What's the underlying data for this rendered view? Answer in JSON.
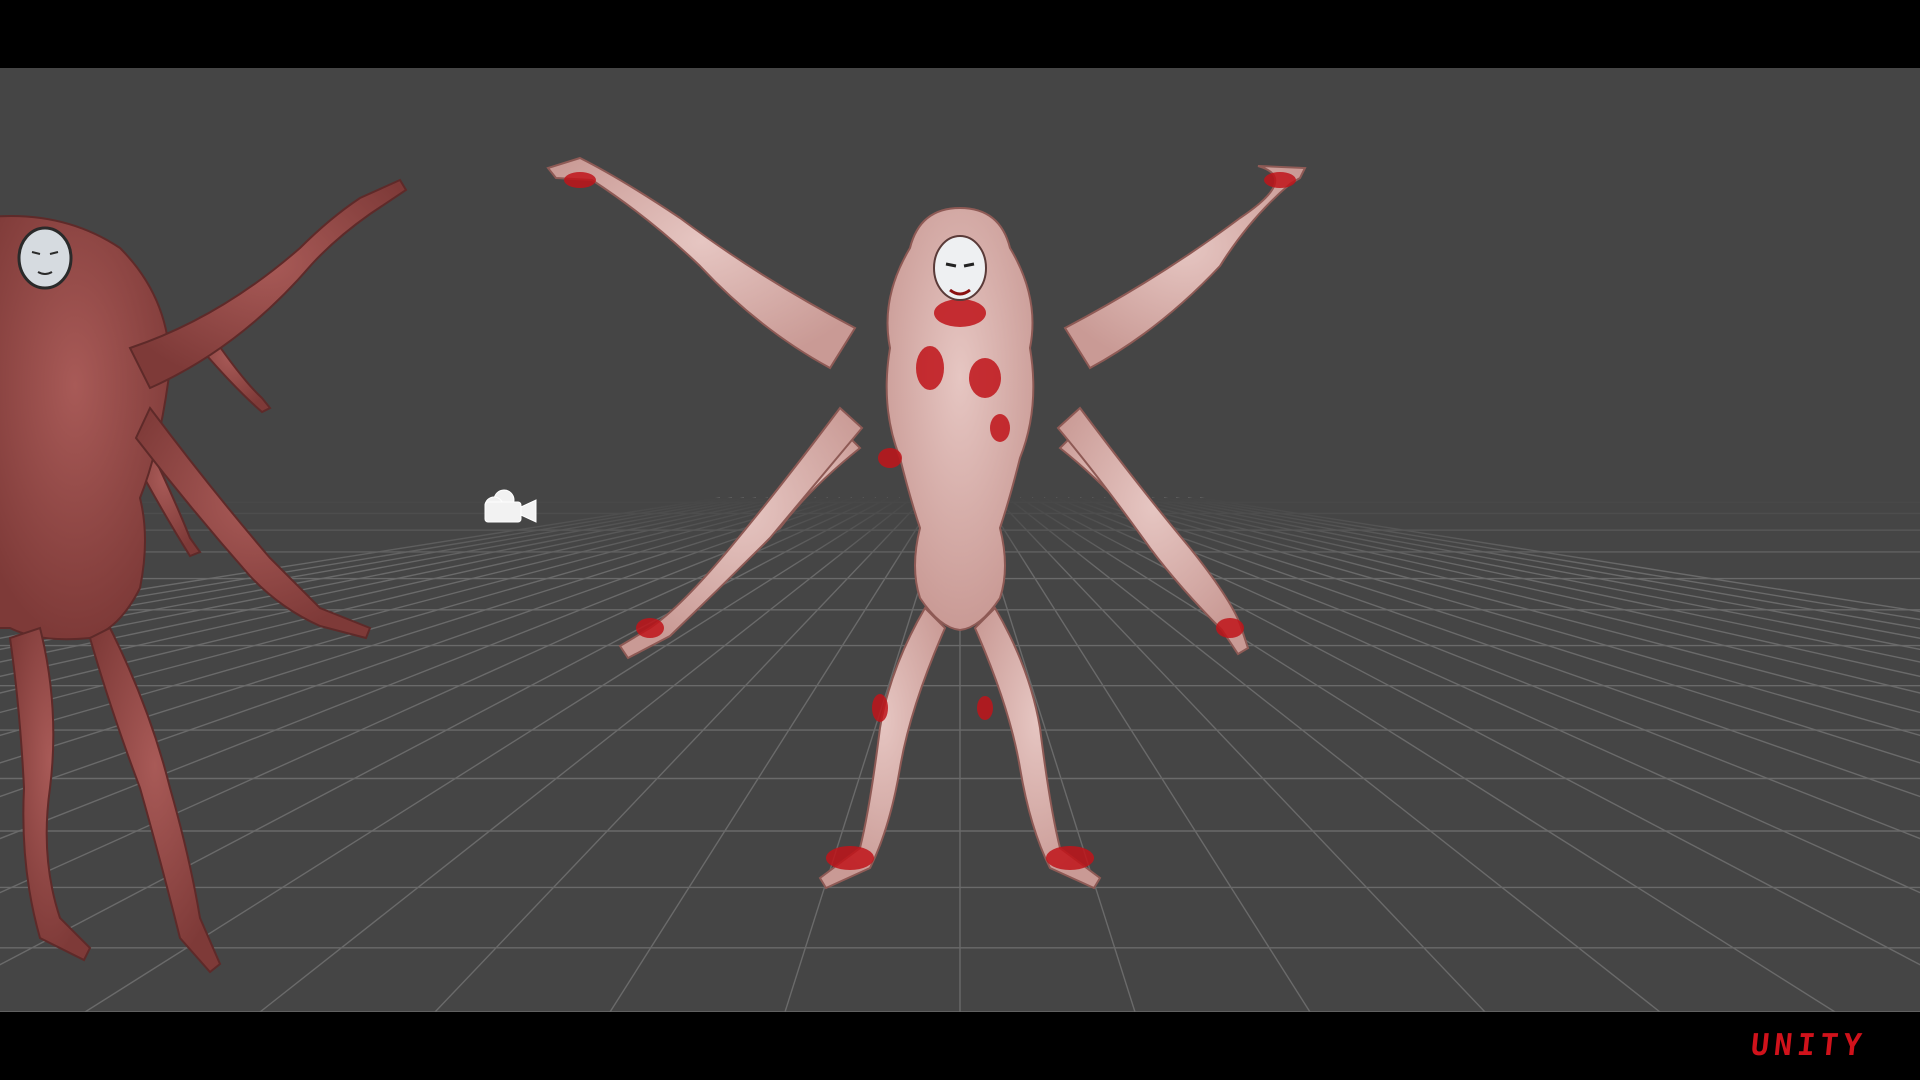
{
  "viewport": {
    "background": "#454545",
    "grid_color": "#6a6a6a",
    "show_grid": true
  },
  "scene": {
    "camera_icon": "camera-gizmo-icon",
    "creature_main": {
      "name_icon": "four-armed-creature-bloody",
      "skin": "#d8b4b0",
      "blood": "#c0141a"
    },
    "creature_side": {
      "name_icon": "four-armed-creature-flesh",
      "skin": "#9a4a48"
    }
  },
  "overlay": {
    "watermark": "UNITY",
    "watermark_color": "#d0121b"
  }
}
